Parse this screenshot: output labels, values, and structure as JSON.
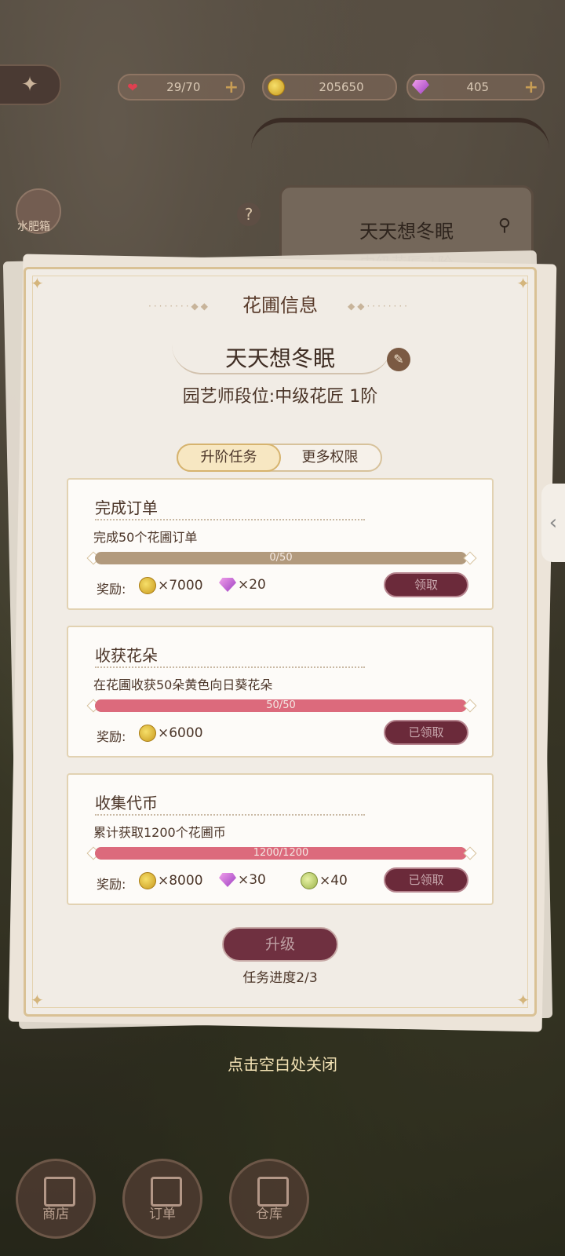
{
  "hud": {
    "hearts": "29/70",
    "coins": "205650",
    "gems": "405"
  },
  "background": {
    "sign_name": "天天想冬眠",
    "sign_rank": "中级花匠 1阶",
    "side_label": "水肥箱"
  },
  "panel": {
    "title": "花圃信息",
    "garden_name": "天天想冬眠",
    "rank": "园艺师段位:中级花匠 1阶",
    "tabs": [
      "升阶任务",
      "更多权限"
    ],
    "tasks": [
      {
        "title": "完成订单",
        "desc": "完成50个花圃订单",
        "progress_text": "0/50",
        "progress": 0,
        "reward_label": "奖励:",
        "rewards": [
          {
            "icon": "gold-coin-icon",
            "amount": "×7000"
          },
          {
            "icon": "gem-icon",
            "amount": "×20"
          }
        ],
        "button": "领取"
      },
      {
        "title": "收获花朵",
        "desc": "在花圃收获50朵黄色向日葵花朵",
        "progress_text": "50/50",
        "progress": 1,
        "reward_label": "奖励:",
        "rewards": [
          {
            "icon": "gold-coin-icon",
            "amount": "×6000"
          }
        ],
        "button": "已领取"
      },
      {
        "title": "收集代币",
        "desc": "累计获取1200个花圃币",
        "progress_text": "1200/1200",
        "progress": 1,
        "reward_label": "奖励:",
        "rewards": [
          {
            "icon": "gold-coin-icon",
            "amount": "×8000"
          },
          {
            "icon": "gem-icon",
            "amount": "×30"
          },
          {
            "icon": "garden-coin-icon",
            "amount": "×40"
          }
        ],
        "button": "已领取"
      }
    ],
    "upgrade_button": "升级",
    "task_progress": "任务进度2/3"
  },
  "close_hint": "点击空白处关闭",
  "nav": [
    "商店",
    "订单",
    "仓库"
  ],
  "colors": {
    "accent_pink": "#dc6a7c",
    "button_maroon": "#6b2a3a",
    "panel_bg": "#f1ece5",
    "gold_border": "#d9c195"
  }
}
